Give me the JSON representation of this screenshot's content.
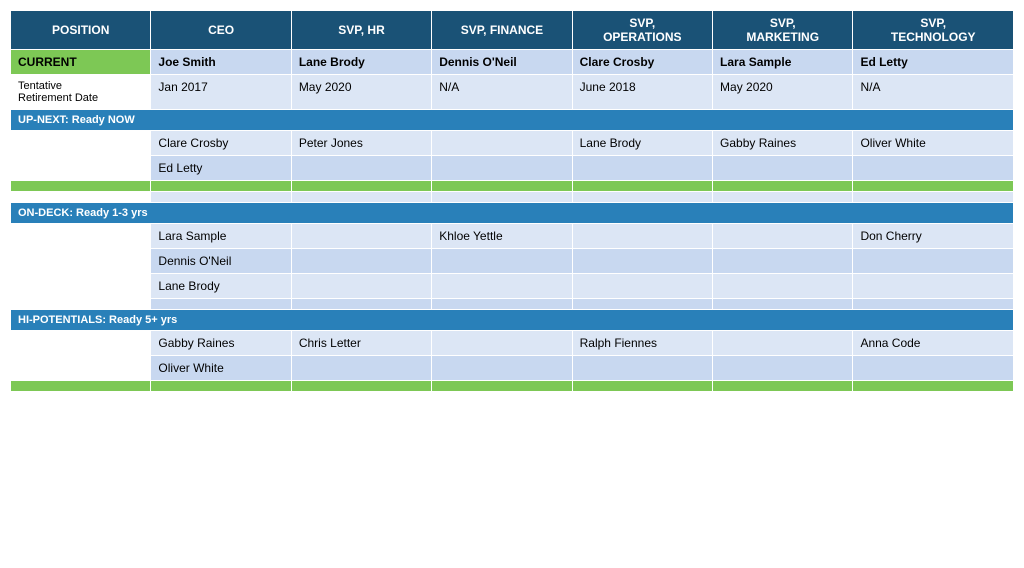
{
  "headers": {
    "position": "POSITION",
    "ceo": "CEO",
    "svphr": "SVP, HR",
    "svpfin": "SVP, FINANCE",
    "svpops": "SVP,\nOPERATIONS",
    "svpmkt": "SVP,\nMARKETING",
    "svptech": "SVP,\nTECHNOLOGY"
  },
  "current": {
    "label": "CURRENT",
    "ceo": "Joe Smith",
    "svphr": "Lane Brody",
    "svpfin": "Dennis O'Neil",
    "svpops": "Clare Crosby",
    "svpmkt": "Lara Sample",
    "svptech": "Ed Letty"
  },
  "tentative": {
    "label": "Tentative\nRetirement Date",
    "ceo": "Jan 2017",
    "svphr": "May 2020",
    "svpfin": "N/A",
    "svpops": "June 2018",
    "svpmkt": "May 2020",
    "svptech": "N/A"
  },
  "upnext": {
    "section_label": "UP-NEXT: Ready NOW",
    "rows": [
      {
        "pos": "",
        "ceo": "Clare Crosby",
        "svphr": "Peter Jones",
        "svpfin": "",
        "svpops": "Lane Brody",
        "svpmkt": "Gabby Raines",
        "svptech": "Oliver White"
      },
      {
        "pos": "",
        "ceo": "Ed Letty",
        "svphr": "",
        "svpfin": "",
        "svpops": "",
        "svpmkt": "",
        "svptech": ""
      },
      {
        "pos": "",
        "ceo": "",
        "svphr": "",
        "svpfin": "",
        "svpops": "",
        "svpmkt": "",
        "svptech": ""
      },
      {
        "pos": "",
        "ceo": "",
        "svphr": "",
        "svpfin": "",
        "svpops": "",
        "svpmkt": "",
        "svptech": ""
      }
    ]
  },
  "ondeck": {
    "section_label": "ON-DECK: Ready 1-3 yrs",
    "rows": [
      {
        "pos": "",
        "ceo": "Lara Sample",
        "svphr": "",
        "svpfin": "Khloe Yettle",
        "svpops": "",
        "svpmkt": "",
        "svptech": "Don Cherry"
      },
      {
        "pos": "",
        "ceo": "Dennis O'Neil",
        "svphr": "",
        "svpfin": "",
        "svpops": "",
        "svpmkt": "",
        "svptech": ""
      },
      {
        "pos": "",
        "ceo": "Lane Brody",
        "svphr": "",
        "svpfin": "",
        "svpops": "",
        "svpmkt": "",
        "svptech": ""
      },
      {
        "pos": "",
        "ceo": "",
        "svphr": "",
        "svpfin": "",
        "svpops": "",
        "svpmkt": "",
        "svptech": ""
      }
    ]
  },
  "hipotentials": {
    "section_label": "HI-POTENTIALS: Ready 5+ yrs",
    "rows": [
      {
        "pos": "",
        "ceo": "Gabby Raines",
        "svphr": "Chris Letter",
        "svpfin": "",
        "svpops": "Ralph Fiennes",
        "svpmkt": "",
        "svptech": "Anna Code"
      },
      {
        "pos": "",
        "ceo": "Oliver White",
        "svphr": "",
        "svpfin": "",
        "svpops": "",
        "svpmkt": "",
        "svptech": ""
      },
      {
        "pos": "",
        "ceo": "",
        "svphr": "",
        "svpfin": "",
        "svpops": "",
        "svpmkt": "",
        "svptech": ""
      }
    ]
  }
}
